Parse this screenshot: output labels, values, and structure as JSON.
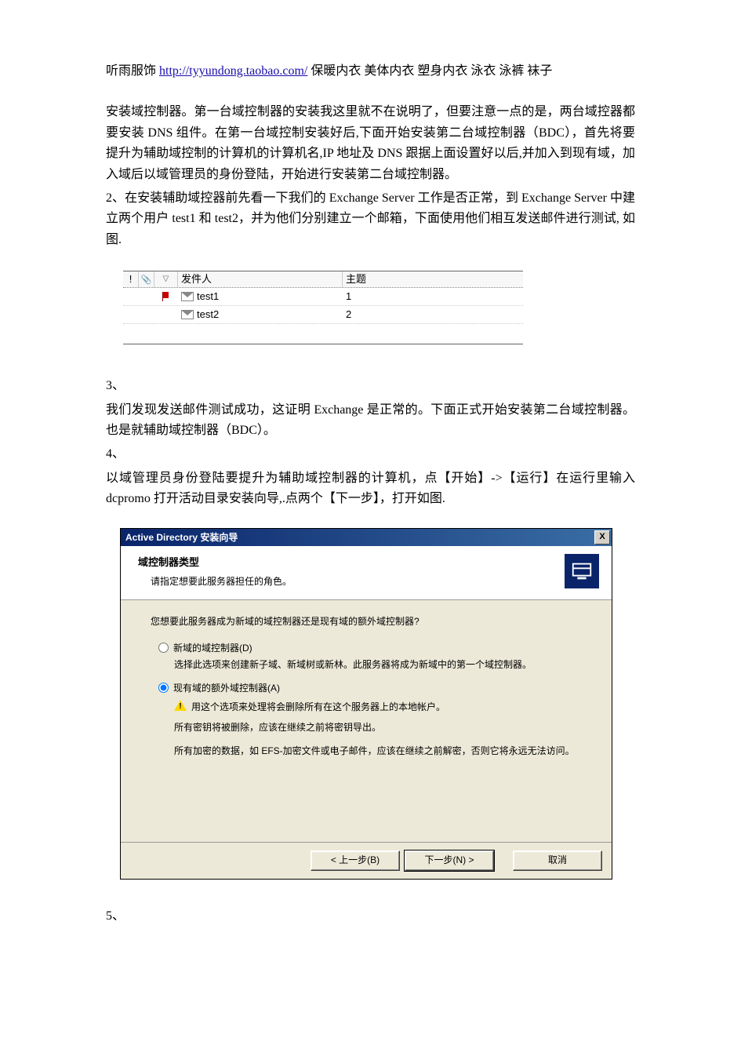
{
  "header": {
    "prefix": "听雨服饰 ",
    "url": "http://tyyundong.taobao.com/",
    "suffix": "  保暖内衣  美体内衣  塑身内衣  泳衣  泳裤  袜子"
  },
  "paragraphs": {
    "p1": "安装域控制器。第一台域控制器的安装我这里就不在说明了，但要注意一点的是，两台域控器都要安装 DNS 组件。在第一台域控制安装好后,下面开始安装第二台域控制器（BDC），首先将要提升为辅助域控制的计算机的计算机名,IP 地址及 DNS 跟据上面设置好以后,并加入到现有域，加入域后以域管理员的身份登陆，开始进行安装第二台域控制器。",
    "p2": "2、在安装辅助域控器前先看一下我们的 Exchange  Server 工作是否正常，到 Exchange  Server 中建立两个用户 test1 和 test2，并为他们分别建立一个邮箱，下面使用他们相互发送邮件进行测试, 如图.",
    "p3a": "3、",
    "p3b": "我们发现发送邮件测试成功，这证明 Exchange 是正常的。下面正式开始安装第二台域控制器。也是就辅助域控制器（BDC）。",
    "p4a": "4、",
    "p4b": "以域管理员身份登陆要提升为辅助域控制器的计算机，点【开始】->【运行】在运行里输入 dcpromo 打开活动目录安装向导,.点两个【下一步】，打开如图.",
    "p5": "5、"
  },
  "mail": {
    "col_excl": "!",
    "col_clip": "",
    "col_flag": "",
    "col_sender": "发件人",
    "col_subject": "主题",
    "rows": [
      {
        "sender": "test1",
        "subject": "1",
        "flag": true
      },
      {
        "sender": "test2",
        "subject": "2",
        "flag": false
      }
    ]
  },
  "wizard": {
    "title": "Active Directory 安装向导",
    "close": "X",
    "header_title": "域控制器类型",
    "header_sub": "请指定想要此服务器担任的角色。",
    "question": "您想要此服务器成为新域的域控制器还是现有域的额外域控制器?",
    "opt1_label": "新域的域控制器(D)",
    "opt1_desc": "选择此选项来创建新子域、新域树或新林。此服务器将成为新域中的第一个域控制器。",
    "opt2_label": "现有域的额外域控制器(A)",
    "opt2_warn": "用这个选项来处理将会删除所有在这个服务器上的本地帐户。",
    "opt2_line2": "所有密钥将被删除，应该在继续之前将密钥导出。",
    "opt2_line3": "所有加密的数据，如 EFS-加密文件或电子邮件，应该在继续之前解密，否则它将永远无法访问。",
    "btn_back": "< 上一步(B)",
    "btn_next": "下一步(N) >",
    "btn_cancel": "取消"
  }
}
